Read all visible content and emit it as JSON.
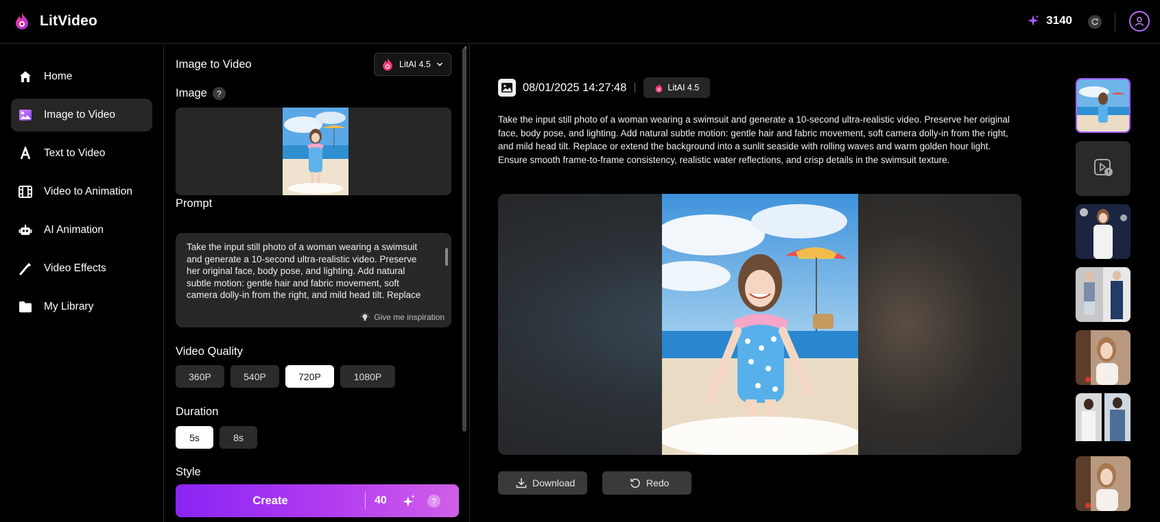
{
  "app": {
    "name": "LitVideo",
    "credits": "3140"
  },
  "sidebar": {
    "items": [
      {
        "label": "Home",
        "icon": "home-icon"
      },
      {
        "label": "Image to Video",
        "icon": "image-icon",
        "active": true
      },
      {
        "label": "Text to Video",
        "icon": "text-icon"
      },
      {
        "label": "Video to Animation",
        "icon": "film-icon"
      },
      {
        "label": "AI Animation",
        "icon": "robot-icon"
      },
      {
        "label": "Video Effects",
        "icon": "wand-icon"
      },
      {
        "label": "My Library",
        "icon": "folder-icon"
      }
    ]
  },
  "panel": {
    "title": "Image to Video",
    "model": "LitAI 4.5",
    "image_label": "Image",
    "prompt_label": "Prompt",
    "prompt_text": "Take the input still photo of a woman wearing a swimsuit and generate a 10-second ultra-realistic video. Preserve her original face, body pose, and lighting. Add natural subtle motion: gentle hair and fabric movement, soft camera dolly-in from the right, and mild head tilt. Replace or extend the background into a sunlit seaside with rolling waves and warm golden hour light. Ensure smooth frame-to-frame consistency, realistic water reflections, and crisp details in the swimsuit texture.",
    "inspiration": "Give me inspiration",
    "quality_label": "Video Quality",
    "qualities": [
      "360P",
      "540P",
      "720P",
      "1080P"
    ],
    "quality_selected": "720P",
    "duration_label": "Duration",
    "durations": [
      "5s",
      "8s"
    ],
    "duration_selected": "5s",
    "style_label": "Style",
    "create_label": "Create",
    "create_cost": "40",
    "help": "?"
  },
  "result": {
    "date": "08/01/2025 14:27:48",
    "model": "LitAI 4.5",
    "description": "Take the input still photo of a woman wearing a swimsuit and generate a 10-second ultra-realistic video. Preserve her original face, body pose, and lighting. Add natural subtle motion: gentle hair and fabric movement, soft camera dolly-in from the right, and mild head tilt. Replace or extend the background into a sunlit seaside with rolling waves and warm golden hour light. Ensure smooth frame-to-frame consistency, realistic water reflections, and crisp details in the swimsuit texture.",
    "download": "Download",
    "redo": "Redo"
  },
  "colors": {
    "accent": "#9b2ff5",
    "selected_border": "#a65cff"
  }
}
